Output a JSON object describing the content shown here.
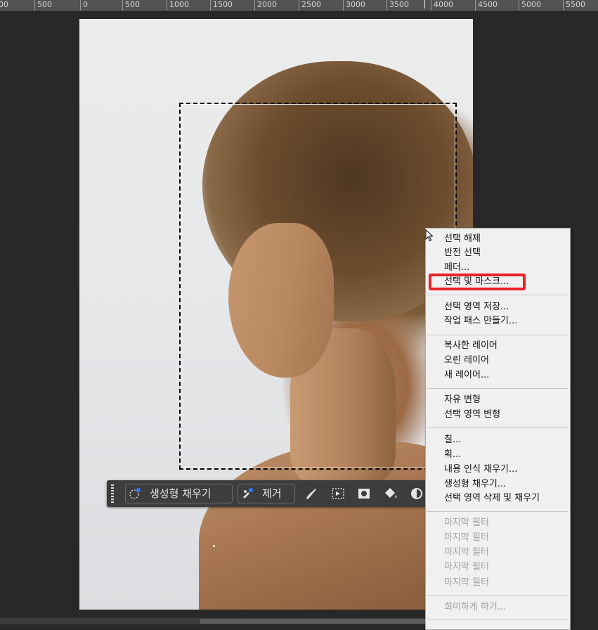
{
  "ruler": {
    "labels": [
      "00",
      "500",
      "0",
      "500",
      "1000",
      "1500",
      "2000",
      "2500",
      "3000",
      "3500",
      "4000",
      "4500",
      "5000",
      "5500"
    ]
  },
  "taskbar": {
    "generative_fill_label": "생성형 채우기",
    "remove_label": "제거",
    "icons": [
      "brush-icon",
      "transform-selection-icon",
      "mask-icon",
      "fill-bucket-icon",
      "adjustment-icon"
    ]
  },
  "context_menu": {
    "group1": [
      "선택 해제",
      "반전 선택",
      "페더...",
      "선택 및 마스크..."
    ],
    "group2": [
      "선택 영역 저장...",
      "작업 패스 만들기..."
    ],
    "group3": [
      "복사한 레이어",
      "오린 레이어",
      "새 레이어..."
    ],
    "group4": [
      "자유 변형",
      "선택 영역 변형"
    ],
    "group5": [
      "칠...",
      "획...",
      "내용 인식 채우기...",
      "생성형 채우기...",
      "선택 영역 삭제 및 채우기"
    ],
    "group6": [
      "마지막 필터",
      "마지막 필터",
      "마지막 필터",
      "마지막 필터",
      "마지막 필터"
    ],
    "group7": [
      "희미하게 하기..."
    ],
    "highlighted_item": "선택 및 마스크...",
    "highlight_color": "#e8212b"
  },
  "colors": {
    "background": "#282828",
    "menu_bg": "#f0f0f0",
    "taskbar_bg": "#3d3d3d"
  }
}
